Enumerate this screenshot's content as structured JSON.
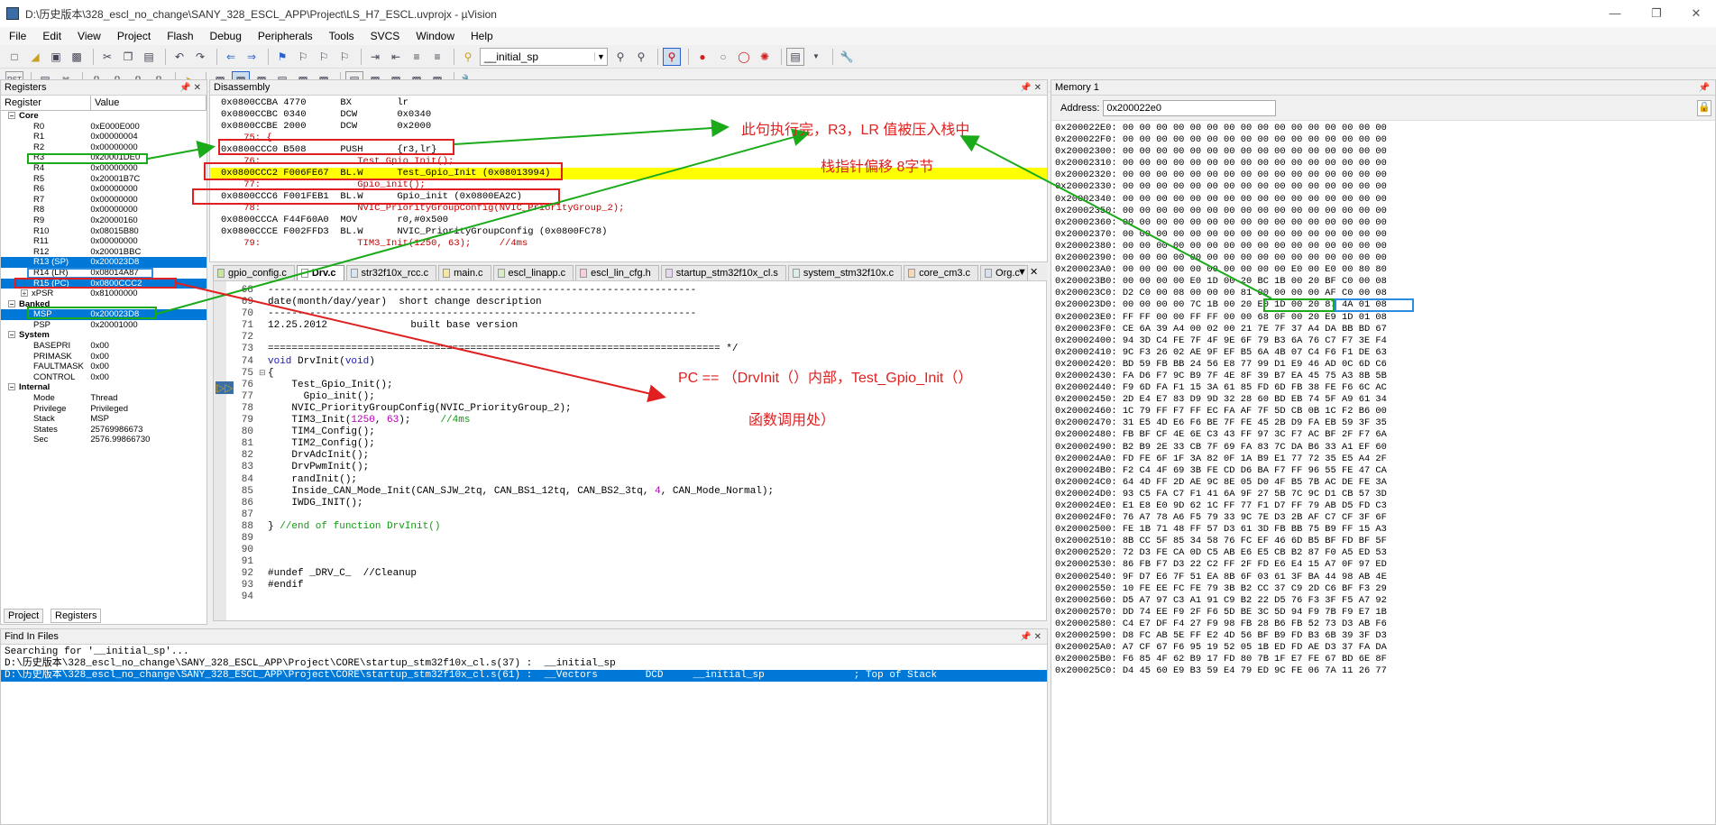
{
  "window": {
    "title": "D:\\历史版本\\328_escl_no_change\\SANY_328_ESCL_APP\\Project\\LS_H7_ESCL.uvprojx - µVision"
  },
  "menu": [
    "File",
    "Edit",
    "View",
    "Project",
    "Flash",
    "Debug",
    "Peripherals",
    "Tools",
    "SVCS",
    "Window",
    "Help"
  ],
  "toolbar": {
    "combo_value": "__initial_sp",
    "rst_label": "RST"
  },
  "registers": {
    "title": "Registers",
    "col_register": "Register",
    "col_value": "Value",
    "rows": [
      {
        "name": "Core",
        "value": "",
        "level": 0,
        "group": true
      },
      {
        "name": "R0",
        "value": "0xE000E000",
        "level": 2
      },
      {
        "name": "R1",
        "value": "0x00000004",
        "level": 2
      },
      {
        "name": "R2",
        "value": "0x00000000",
        "level": 2
      },
      {
        "name": "R3",
        "value": "0x20001DE0",
        "level": 2
      },
      {
        "name": "R4",
        "value": "0x00000000",
        "level": 2
      },
      {
        "name": "R5",
        "value": "0x20001B7C",
        "level": 2
      },
      {
        "name": "R6",
        "value": "0x00000000",
        "level": 2
      },
      {
        "name": "R7",
        "value": "0x00000000",
        "level": 2
      },
      {
        "name": "R8",
        "value": "0x00000000",
        "level": 2
      },
      {
        "name": "R9",
        "value": "0x20000160",
        "level": 2
      },
      {
        "name": "R10",
        "value": "0x08015B80",
        "level": 2
      },
      {
        "name": "R11",
        "value": "0x00000000",
        "level": 2
      },
      {
        "name": "R12",
        "value": "0x20001BBC",
        "level": 2
      },
      {
        "name": "R13 (SP)",
        "value": "0x200023D8",
        "level": 2,
        "sel": true
      },
      {
        "name": "R14 (LR)",
        "value": "0x08014A87",
        "level": 2
      },
      {
        "name": "R15 (PC)",
        "value": "0x0800CCC2",
        "level": 2,
        "sel": true
      },
      {
        "name": "xPSR",
        "value": "0x81000000",
        "level": 1,
        "plus": true
      },
      {
        "name": "Banked",
        "value": "",
        "level": 0,
        "group": true
      },
      {
        "name": "MSP",
        "value": "0x200023D8",
        "level": 2,
        "sel": true
      },
      {
        "name": "PSP",
        "value": "0x20001000",
        "level": 2
      },
      {
        "name": "System",
        "value": "",
        "level": 0,
        "group": true
      },
      {
        "name": "BASEPRI",
        "value": "0x00",
        "level": 2
      },
      {
        "name": "PRIMASK",
        "value": "0x00",
        "level": 2
      },
      {
        "name": "FAULTMASK",
        "value": "0x00",
        "level": 2
      },
      {
        "name": "CONTROL",
        "value": "0x00",
        "level": 2
      },
      {
        "name": "Internal",
        "value": "",
        "level": 0,
        "group": true
      },
      {
        "name": "Mode",
        "value": "Thread",
        "level": 2
      },
      {
        "name": "Privilege",
        "value": "Privileged",
        "level": 2
      },
      {
        "name": "Stack",
        "value": "MSP",
        "level": 2
      },
      {
        "name": "States",
        "value": "25769986673",
        "level": 2
      },
      {
        "name": "Sec",
        "value": "2576.99866730",
        "level": 2
      }
    ],
    "bottom_tabs": [
      "Project",
      "Registers"
    ]
  },
  "disassembly": {
    "title": "Disassembly",
    "lines": [
      {
        "t": "0x0800CCBA 4770      BX        lr",
        "k": "asm"
      },
      {
        "t": "0x0800CCBC 0340      DCW       0x0340",
        "k": "asm"
      },
      {
        "t": "0x0800CCBE 2000      DCW       0x2000",
        "k": "asm"
      },
      {
        "t": "    75: {",
        "k": "src"
      },
      {
        "t": "0x0800CCC0 B508      PUSH      {r3,lr}",
        "k": "asm"
      },
      {
        "t": "    76:                 Test_Gpio_Init();",
        "k": "src"
      },
      {
        "t": "0x0800CCC2 F006FE67  BL.W      Test_Gpio_Init (0x08013994)",
        "k": "hl"
      },
      {
        "t": "    77:                 Gpio_init();",
        "k": "src"
      },
      {
        "t": "0x0800CCC6 F001FEB1  BL.W      Gpio_init (0x0800EA2C)",
        "k": "asm"
      },
      {
        "t": "    78:                 NVIC_PriorityGroupConfig(NVIC_PriorityGroup_2);",
        "k": "src"
      },
      {
        "t": "0x0800CCCA F44F60A0  MOV       r0,#0x500",
        "k": "asm"
      },
      {
        "t": "0x0800CCCE F002FFD3  BL.W      NVIC_PriorityGroupConfig (0x0800FC78)",
        "k": "asm"
      },
      {
        "t": "    79:                 TIM3_Init(1250, 63);     //4ms",
        "k": "src"
      }
    ]
  },
  "tabs": [
    {
      "label": "gpio_config.c",
      "color": "#c8e6a0"
    },
    {
      "label": "Drv.c",
      "color": "#ffffff",
      "active": true
    },
    {
      "label": "str32f10x_rcc.c",
      "color": "#d6e6f5"
    },
    {
      "label": "main.c",
      "color": "#f5e6a0"
    },
    {
      "label": "escl_linapp.c",
      "color": "#d8ecc8"
    },
    {
      "label": "escl_lin_cfg.h",
      "color": "#f5d0d8"
    },
    {
      "label": "startup_stm32f10x_cl.s",
      "color": "#e6d8f0"
    },
    {
      "label": "system_stm32f10x.c",
      "color": "#d8f0e6"
    },
    {
      "label": "core_cm3.c",
      "color": "#f5d8b8"
    },
    {
      "label": "Org.c",
      "color": "#d8e0f0"
    }
  ],
  "editor": {
    "lines": [
      {
        "n": "68",
        "t": "------------------------------------------------------------------------",
        "c": "cm"
      },
      {
        "n": "69",
        "t": "date(month/day/year)  short change description",
        "c": "cm"
      },
      {
        "n": "70",
        "t": "------------------------------------------------------------------------",
        "c": "cm"
      },
      {
        "n": "71",
        "t": "12.25.2012              built base version",
        "c": "cm"
      },
      {
        "n": "72",
        "t": "",
        "c": ""
      },
      {
        "n": "73",
        "t": "============================================================================ */",
        "c": "cm"
      },
      {
        "n": "74",
        "t": "void DrvInit(void)",
        "c": "kw"
      },
      {
        "n": "75",
        "t": "{",
        "c": "",
        "fold": true
      },
      {
        "n": "76",
        "t": "    Test_Gpio_Init();",
        "c": ""
      },
      {
        "n": "77",
        "t": "      Gpio_init();",
        "c": ""
      },
      {
        "n": "78",
        "t": "    NVIC_PriorityGroupConfig(NVIC_PriorityGroup_2);",
        "c": ""
      },
      {
        "n": "79",
        "t": "    TIM3_Init(1250, 63);     //4ms",
        "c": "mix79"
      },
      {
        "n": "80",
        "t": "    TIM4_Config();",
        "c": ""
      },
      {
        "n": "81",
        "t": "    TIM2_Config();",
        "c": ""
      },
      {
        "n": "82",
        "t": "    DrvAdcInit();",
        "c": ""
      },
      {
        "n": "83",
        "t": "    DrvPwmInit();",
        "c": ""
      },
      {
        "n": "84",
        "t": "    randInit();",
        "c": ""
      },
      {
        "n": "85",
        "t": "    Inside_CAN_Mode_Init(CAN_SJW_2tq, CAN_BS1_12tq, CAN_BS2_3tq, 4, CAN_Mode_Normal);",
        "c": ""
      },
      {
        "n": "86",
        "t": "    IWDG_INIT();",
        "c": ""
      },
      {
        "n": "87",
        "t": "",
        "c": ""
      },
      {
        "n": "88",
        "t": "} //end of function DrvInit()",
        "c": "mix88"
      },
      {
        "n": "89",
        "t": "",
        "c": ""
      },
      {
        "n": "90",
        "t": "",
        "c": ""
      },
      {
        "n": "91",
        "t": "",
        "c": ""
      },
      {
        "n": "92",
        "t": "#undef _DRV_C_  //Cleanup",
        "c": "cm"
      },
      {
        "n": "93",
        "t": "#endif",
        "c": "cm"
      },
      {
        "n": "94",
        "t": "",
        "c": ""
      }
    ]
  },
  "memory": {
    "title": "Memory 1",
    "address_label": "Address:",
    "address_value": "0x200022e0",
    "rows": [
      "0x200022E0: 00 00 00 00 00 00 00 00 00 00 00 00 00 00 00 00",
      "0x200022F0: 00 00 00 00 00 00 00 00 00 00 00 00 00 00 00 00",
      "0x20002300: 00 00 00 00 00 00 00 00 00 00 00 00 00 00 00 00",
      "0x20002310: 00 00 00 00 00 00 00 00 00 00 00 00 00 00 00 00",
      "0x20002320: 00 00 00 00 00 00 00 00 00 00 00 00 00 00 00 00",
      "0x20002330: 00 00 00 00 00 00 00 00 00 00 00 00 00 00 00 00",
      "0x20002340: 00 00 00 00 00 00 00 00 00 00 00 00 00 00 00 00",
      "0x20002350: 00 00 00 00 00 00 00 00 00 00 00 00 00 00 00 00",
      "0x20002360: 00 00 00 00 00 00 00 00 00 00 00 00 00 00 00 00",
      "0x20002370: 00 00 00 00 00 00 00 00 00 00 00 00 00 00 00 00",
      "0x20002380: 00 00 00 00 00 00 00 00 00 00 00 00 00 00 00 00",
      "0x20002390: 00 00 00 00 00 00 00 00 00 00 00 00 00 00 00 00",
      "0x200023A0: 00 00 00 00 00 00 00 00 00 00 E0 00 E0 00 80 80",
      "0x200023B0: 00 00 00 00 E0 1D 00 20 BC 1B 00 20 BF C0 00 08",
      "0x200023C0: D2 C0 00 08 00 00 00 81 00 00 00 00 AF C0 00 08",
      "0x200023D0: 00 00 00 00 7C 1B 00 20 E0 1D 00 20 87 4A 01 08",
      "0x200023E0: FF FF 00 00 FF FF 00 00 68 0F 00 20 E9 1D 01 08",
      "0x200023F0: CE 6A 39 A4 00 02 00 21 7E 7F 37 A4 DA BB BD 67",
      "0x20002400: 94 3D C4 FE 7F 4F 9E 6F 79 B3 6A 76 C7 F7 3E F4",
      "0x20002410: 9C F3 26 02 AE 9F EF B5 6A 4B 07 C4 F6 F1 DE 63",
      "0x20002420: BD 59 FB BB 24 56 E8 77 99 D1 E9 46 AD 0C 6D C6",
      "0x20002430: FA D6 F7 9C B9 7F 4E 8F 39 B7 EA 45 75 A3 8B 5B",
      "0x20002440: F9 6D FA F1 15 3A 61 85 FD 6D FB 38 FE F6 6C AC",
      "0x20002450: 2D E4 E7 83 D9 9D 32 28 60 BD EB 74 5F A9 61 34",
      "0x20002460: 1C 79 FF F7 FF EC FA AF 7F 5D CB 0B 1C F2 B6 00",
      "0x20002470: 31 E5 4D E6 F6 BE 7F FE 45 2B D9 FA EB 59 3F 35",
      "0x20002480: FB BF CF 4E 6E C3 43 FF 97 3C F7 AC BF 2F F7 6A",
      "0x20002490: B2 B9 2E 33 CB 7F 69 FA 83 7C DA B6 33 A1 EF 60",
      "0x200024A0: FD FE 6F 1F 3A 82 0F 1A B9 E1 77 72 35 E5 A4 2F",
      "0x200024B0: F2 C4 4F 69 3B FE CD D6 BA F7 FF 96 55 FE 47 CA",
      "0x200024C0: 64 4D FF 2D AE 9C 8E 05 D0 4F B5 7B AC DE FE 3A",
      "0x200024D0: 93 C5 FA C7 F1 41 6A 9F 27 5B 7C 9C D1 CB 57 3D",
      "0x200024E0: E1 E8 E0 9D 62 1C FF 77 F1 D7 FF 79 AB D5 FD C3",
      "0x200024F0: 76 A7 78 A6 F5 79 33 9C 7E D3 2B AF C7 CF 3F 6F",
      "0x20002500: FE 1B 71 48 FF 57 D3 61 3D FB BB 75 B9 FF 15 A3",
      "0x20002510: 8B CC 5F 85 34 58 76 FC EF 46 6D B5 BF FD BF 5F",
      "0x20002520: 72 D3 FE CA 0D C5 AB E6 E5 CB B2 87 F0 A5 ED 53",
      "0x20002530: 86 FB F7 D3 22 C2 FF 2F FD E6 E4 15 A7 0F 97 ED",
      "0x20002540: 9F D7 E6 7F 51 EA 8B 6F 03 61 3F BA 44 98 AB 4E",
      "0x20002550: 10 FE EE FC FE 79 3B B2 CC 37 C9 2D C6 BF F3 29",
      "0x20002560: D5 A7 97 C3 A1 91 C9 B2 22 D5 76 F3 3F F5 A7 92",
      "0x20002570: DD 74 EE F9 2F F6 5D BE 3C 5D 94 F9 7B F9 E7 1B",
      "0x20002580: C4 E7 DF F4 27 F9 98 FB 28 B6 FB 52 73 D3 AB F6",
      "0x20002590: D8 FC AB 5E FF E2 4D 56 BF B9 FD B3 6B 39 3F D3",
      "0x200025A0: A7 CF 67 F6 95 19 52 05 1B ED FD AE D3 37 FA DA",
      "0x200025B0: F6 85 4F 62 B9 17 FD 80 7B 1F E7 FE 67 BD 6E 8F",
      "0x200025C0: D4 45 60 E9 B3 59 E4 79 ED 9C FE 06 7A 11 26 77"
    ]
  },
  "findinfiles": {
    "title": "Find In Files",
    "lines": [
      {
        "t": "Searching for '__initial_sp'...",
        "sel": false
      },
      {
        "t": "D:\\历史版本\\328_escl_no_change\\SANY_328_ESCL_APP\\Project\\CORE\\startup_stm32f10x_cl.s(37) :  __initial_sp",
        "sel": false
      },
      {
        "t": "D:\\历史版本\\328_escl_no_change\\SANY_328_ESCL_APP\\Project\\CORE\\startup_stm32f10x_cl.s(61) :  __Vectors        DCD     __initial_sp               ; Top of Stack",
        "sel": true
      }
    ]
  },
  "annotations": {
    "a1": "此句执行完，R3，LR 值被压入栈中",
    "a2": "栈指针偏移  8字节",
    "a3": "PC ==  （DrvInit（）内部，Test_Gpio_Init（）",
    "a4": "函数调用处）"
  },
  "colors": {
    "red": "#e02020",
    "green": "#1aaa1a",
    "blue": "#2a8de0",
    "highlight": "#ffff00",
    "select": "#0078d7"
  }
}
